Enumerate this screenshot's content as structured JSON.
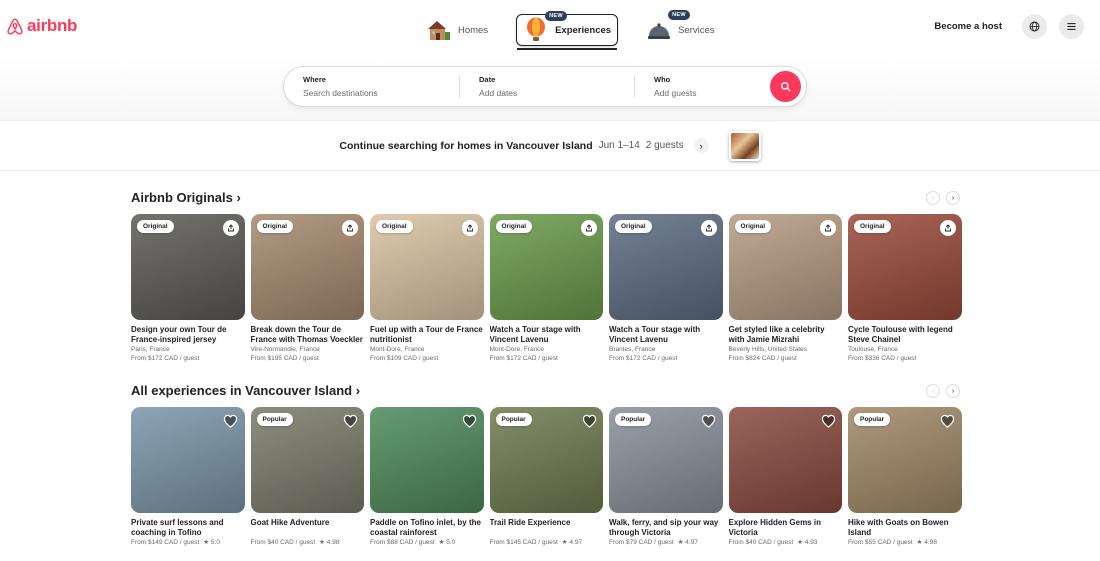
{
  "brand": {
    "name": "airbnb",
    "color": "#ff385c"
  },
  "nav": {
    "items": [
      {
        "label": "Homes",
        "icon": "house-icon",
        "badge": ""
      },
      {
        "label": "Experiences",
        "icon": "hot-air-balloon-icon",
        "badge": "NEW"
      },
      {
        "label": "Services",
        "icon": "service-bell-icon",
        "badge": "NEW"
      }
    ],
    "active": "Experiences"
  },
  "header": {
    "host_label": "Become a host",
    "globe_icon": "globe-icon",
    "menu_icon": "hamburger-menu-icon"
  },
  "search": {
    "where_label": "Where",
    "where_placeholder": "Search destinations",
    "date_label": "Date",
    "date_placeholder": "Add dates",
    "who_label": "Who",
    "who_placeholder": "Add guests",
    "button_icon": "search-icon"
  },
  "continue_searching": {
    "text": "Continue searching for homes in Vancouver Island",
    "dates": "Jun 1–14",
    "guests": "2 guests"
  },
  "originals": {
    "title": "Airbnb Originals ›",
    "cards": [
      {
        "tag": "Original",
        "title": "Design your own Tour de France-inspired jersey",
        "location": "Paris, France",
        "price": "From $172 CAD / guest",
        "bg": "#5b5a57"
      },
      {
        "tag": "Original",
        "title": "Break down the Tour de France with Thomas Voeckler",
        "location": "Vire-Normandie, France",
        "price": "From $195 CAD / guest",
        "bg": "#a58a6f"
      },
      {
        "tag": "Original",
        "title": "Fuel up with a Tour de France nutritionist",
        "location": "Mont-Dore, France",
        "price": "From $109 CAD / guest",
        "bg": "#d9c3a2"
      },
      {
        "tag": "Original",
        "title": "Watch a Tour stage with Vincent Lavenu",
        "location": "Mont-Dore, France",
        "price": "From $172 CAD / guest",
        "bg": "#6a9a4a"
      },
      {
        "tag": "Original",
        "title": "Watch a Tour stage with Vincent Lavenu",
        "location": "Brantes, France",
        "price": "From $172 CAD / guest",
        "bg": "#5d6c82"
      },
      {
        "tag": "Original",
        "title": "Get styled like a celebrity with Jamie Mizrahi",
        "location": "Beverly Hills, United States",
        "price": "From $824 CAD / guest",
        "bg": "#b69b82"
      },
      {
        "tag": "Original",
        "title": "Cycle Toulouse with legend Steve Chainel",
        "location": "Toulouse, France",
        "price": "From $336 CAD / guest",
        "bg": "#9a4a3a"
      }
    ]
  },
  "experiences": {
    "title": "All experiences in Vancouver Island ›",
    "cards": [
      {
        "tag": "",
        "title": "Private surf lessons and coaching in Tofino",
        "price": "From $149 CAD / guest",
        "rating": "★ 5.0",
        "bg": "#7b95a8"
      },
      {
        "tag": "Popular",
        "title": "Goat Hike Adventure",
        "price": "From $40 CAD / guest",
        "rating": "★ 4.98",
        "bg": "#7a7a6a"
      },
      {
        "tag": "",
        "title": "Paddle on Tofino inlet, by the coastal rainforest",
        "price": "From $88 CAD / guest",
        "rating": "★ 5.0",
        "bg": "#4d8a5a"
      },
      {
        "tag": "Popular",
        "title": "Trail Ride Experience",
        "price": "From $145 CAD / guest",
        "rating": "★ 4.97",
        "bg": "#6f7a4e"
      },
      {
        "tag": "Popular",
        "title": "Walk, ferry, and sip your way through Victoria",
        "price": "From $79 CAD / guest",
        "rating": "★ 4.97",
        "bg": "#8a8f99"
      },
      {
        "tag": "",
        "title": "Explore Hidden Gems in Victoria",
        "price": "From $40 CAD / guest",
        "rating": "★ 4.93",
        "bg": "#8a4a3e"
      },
      {
        "tag": "Popular",
        "title": "Hike with Goats on Bowen Island",
        "price": "From $55 CAD / guest",
        "rating": "★ 4.98",
        "bg": "#a08866"
      }
    ]
  }
}
